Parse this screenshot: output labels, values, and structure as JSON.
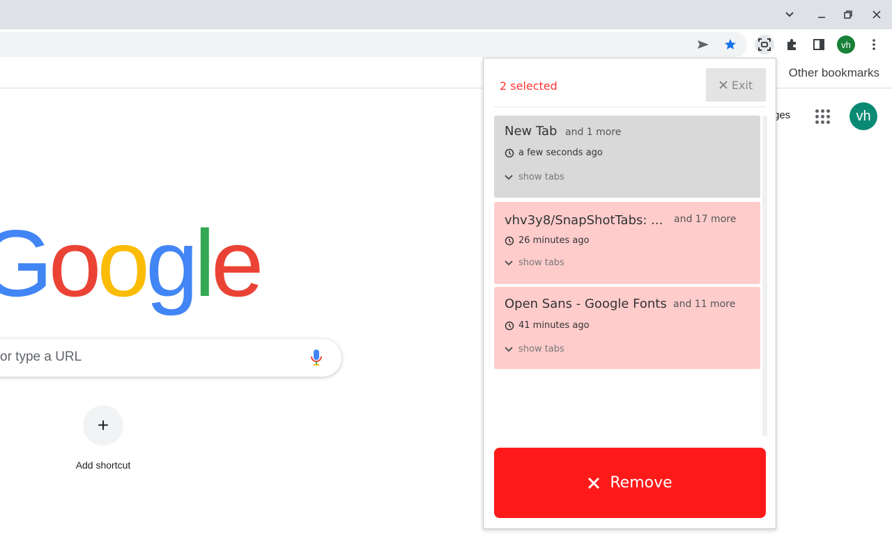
{
  "browser": {
    "other_bookmarks": "Other bookmarks",
    "profile_initials": "vh"
  },
  "ntp": {
    "images_link": "ges",
    "avatar_initials": "vh",
    "logo_letters": [
      {
        "char": "G",
        "color": "#4285F4"
      },
      {
        "char": "o",
        "color": "#EA4335"
      },
      {
        "char": "o",
        "color": "#FBBC05"
      },
      {
        "char": "g",
        "color": "#4285F4"
      },
      {
        "char": "l",
        "color": "#34A853"
      },
      {
        "char": "e",
        "color": "#EA4335"
      }
    ],
    "search_placeholder": "or type a URL",
    "shortcut_icon": "+",
    "shortcut_label": "Add shortcut"
  },
  "popup": {
    "selected_label": "2 selected",
    "exit_label": "Exit",
    "remove_label": "Remove",
    "sessions": [
      {
        "title": "New Tab",
        "more": "and 1 more",
        "time": "a few seconds ago",
        "show_tabs": "show tabs",
        "selected": false
      },
      {
        "title": "vhv3y8/SnapShotTabs: ...",
        "more": "and 17 more",
        "time": "26 minutes ago",
        "show_tabs": "show tabs",
        "selected": true
      },
      {
        "title": "Open Sans - Google Fonts",
        "more": "and 11 more",
        "time": "41 minutes ago",
        "show_tabs": "show tabs",
        "selected": true
      }
    ]
  },
  "colors": {
    "accent_red": "#ff1a1a",
    "selected_text": "#ff3333",
    "card_selected_bg": "#ffcccc",
    "card_unselected_bg": "#d9d9d9",
    "bookmark_star": "#1a73e8"
  }
}
